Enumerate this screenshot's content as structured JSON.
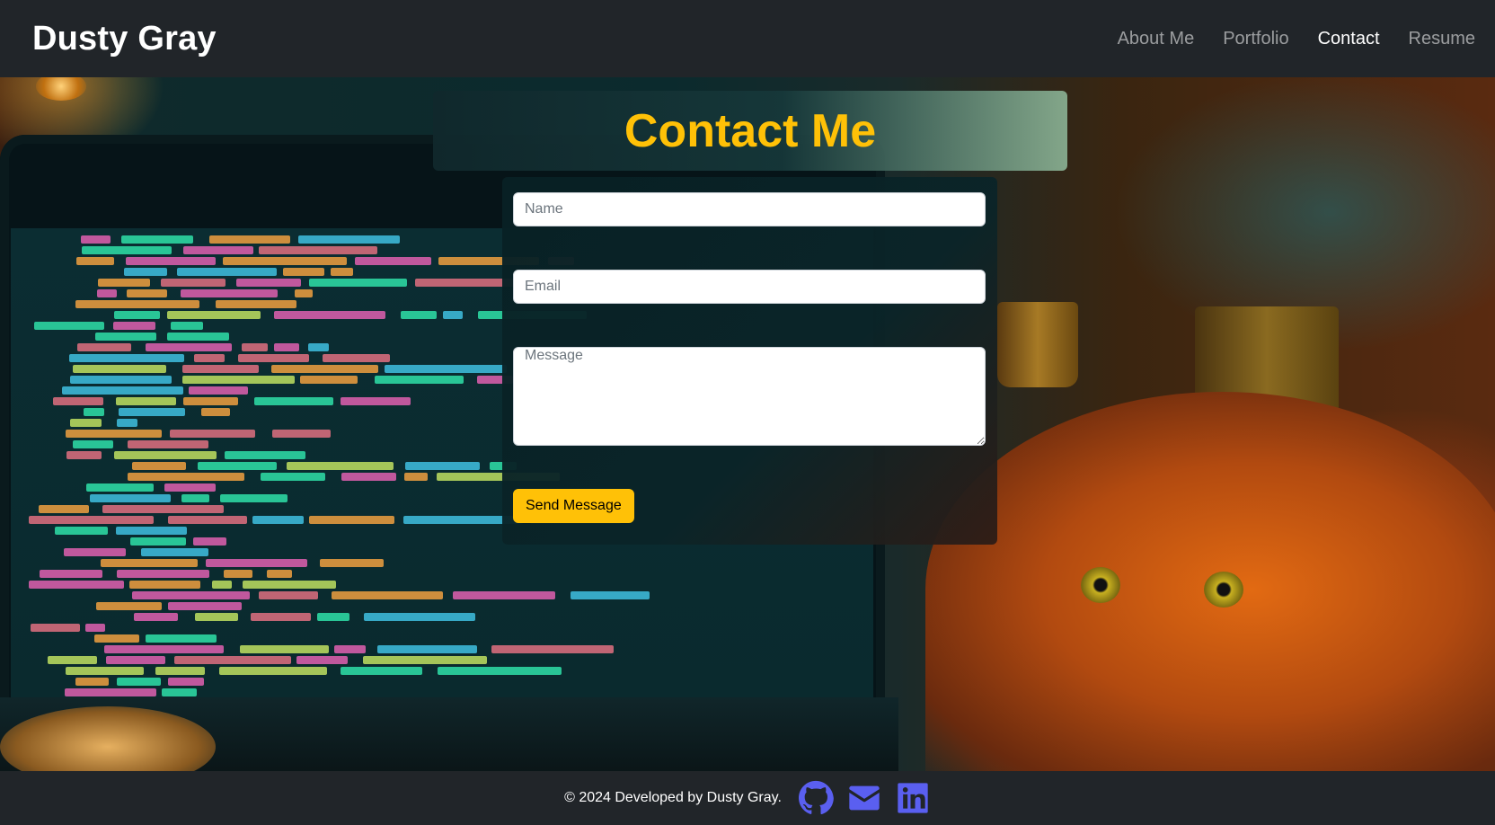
{
  "navbar": {
    "brand": "Dusty Gray",
    "links": [
      {
        "label": "About Me",
        "active": false
      },
      {
        "label": "Portfolio",
        "active": false
      },
      {
        "label": "Contact",
        "active": true
      },
      {
        "label": "Resume",
        "active": false
      }
    ]
  },
  "contact": {
    "title": "Contact Me",
    "fields": {
      "name_placeholder": "Name",
      "email_placeholder": "Email",
      "message_placeholder": "Message"
    },
    "submit_label": "Send Message"
  },
  "footer": {
    "text": "© 2024 Developed by Dusty Gray.",
    "social_icons": [
      "github-icon",
      "envelope-icon",
      "linkedin-icon"
    ]
  },
  "colors": {
    "navbar_bg": "#212529",
    "accent": "#ffc107",
    "social_icon": "#5a5ff0"
  }
}
